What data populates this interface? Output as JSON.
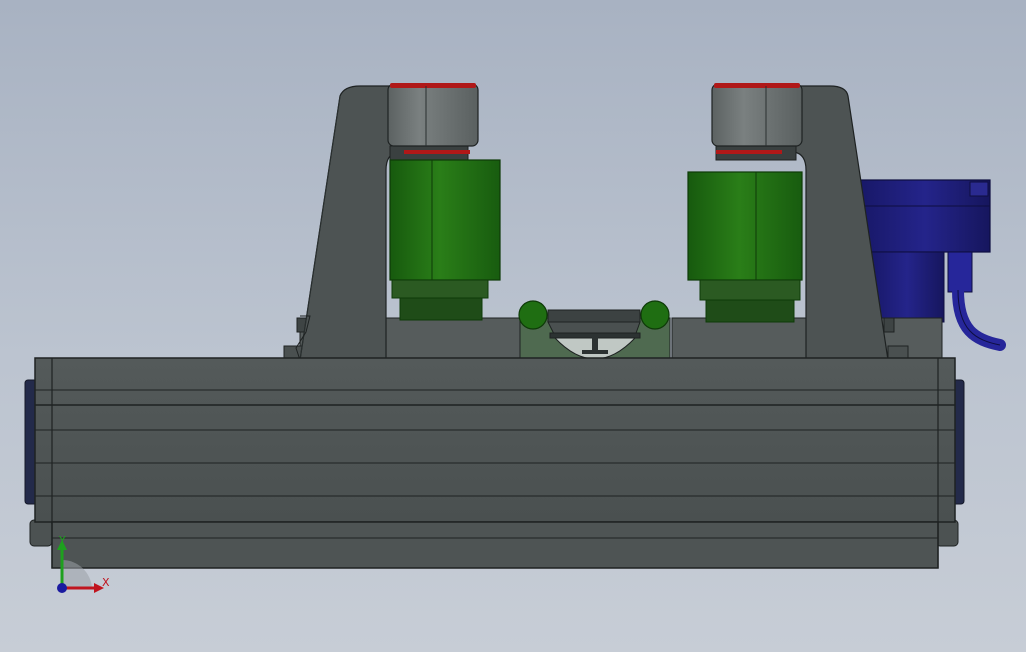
{
  "viewport": {
    "background_top": "#a8b2c2",
    "background_bottom": "#c7cdd6"
  },
  "triad": {
    "x_label": "X",
    "y_label": "Y",
    "x_color": "#c0141e",
    "y_color": "#1ea01e",
    "z_color": "#1a1aa0"
  },
  "colors": {
    "frame_dark": "#4b5050",
    "frame_mid": "#5a6060",
    "cap_gray": "#6c7272",
    "accent_red": "#b01818",
    "coil_green": "#1f6e12",
    "coil_green_dark": "#14500c",
    "motor_blue": "#1c1c78",
    "cable_blue": "#26269a",
    "edge_line": "#1e2222"
  }
}
